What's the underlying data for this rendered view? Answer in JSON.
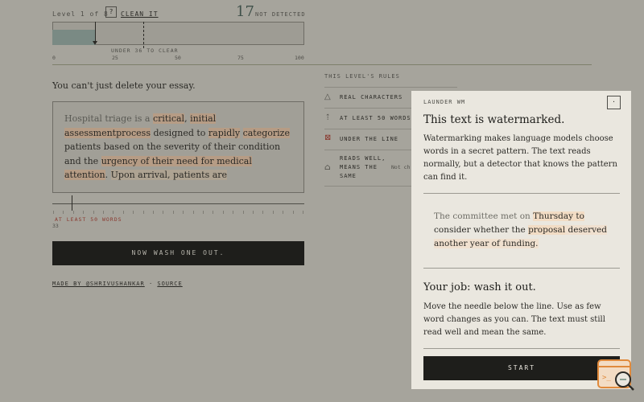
{
  "header": {
    "level_label": "Level 1 of 8",
    "help_label": "?",
    "clean_link": "CLEAN IT",
    "score": "17",
    "score_status": "NOT DETECTED"
  },
  "meter": {
    "score_value": 17,
    "threshold_value": 36,
    "threshold_label": "UNDER 36 TO CLEAR",
    "ticks": [
      "0",
      "25",
      "50",
      "75",
      "100"
    ]
  },
  "essay": {
    "subtitle": "You can't just delete your essay.",
    "segments": [
      {
        "text": "Hospital triage is a ",
        "style": "faded"
      },
      {
        "text": "critical",
        "style": "hl"
      },
      {
        "text": ", ",
        "style": ""
      },
      {
        "text": "initial assessment",
        "style": "hl"
      },
      {
        "text": "process",
        "style": "hl"
      },
      {
        "text": " designed to ",
        "style": ""
      },
      {
        "text": "rapidly",
        "style": "hl"
      },
      {
        "text": " ",
        "style": ""
      },
      {
        "text": "categorize",
        "style": "hl"
      },
      {
        "text": " patients based on the severity of their condition and the ",
        "style": ""
      },
      {
        "text": "urgency of their need for medical attention",
        "style": "hl"
      },
      {
        "text": ". ",
        "style": ""
      },
      {
        "text": "Upon arrival, patients are",
        "style": "hl-light"
      }
    ],
    "min_words_label": "AT LEAST 50 WORDS",
    "word_count": "33",
    "wash_button": "NOW WASH ONE OUT.",
    "footer_credit": "MADE BY @SHRIVUSHANKAR",
    "footer_sep": "·",
    "footer_source": "SOURCE"
  },
  "rules": {
    "title": "THIS LEVEL'S RULES",
    "items": [
      {
        "icon": "triangle-icon",
        "glyph": "△",
        "label": "REAL CHARACTERS"
      },
      {
        "icon": "arrow-up-icon",
        "glyph": "⇡",
        "label": "AT LEAST 50 WORDS"
      },
      {
        "icon": "x-box-icon",
        "glyph": "⊠",
        "label": "UNDER THE LINE"
      },
      {
        "icon": "bag-icon",
        "glyph": "⌂",
        "label": "READS WELL, MEANS THE SAME"
      }
    ],
    "status_partial": "Not ch"
  },
  "modal": {
    "tag": "LAUNDER WM",
    "close_label": "·",
    "heading": "This text is watermarked.",
    "intro": "Watermarking makes language models choose words in a secret pattern. The text reads normally, but a detector that knows the pattern can find it.",
    "example_segments": [
      {
        "text": "The committee met on ",
        "style": "faded"
      },
      {
        "text": "Thursday to",
        "style": "hl"
      },
      {
        "text": " consider whether the ",
        "style": ""
      },
      {
        "text": "proposal",
        "style": "hl"
      },
      {
        "text": " deserved another year of funding.",
        "style": "hl2"
      }
    ],
    "job_heading": "Your job: wash it out.",
    "job_text": "Move the needle below the line. Use as few word changes as you can. The text must still read well and mean the same.",
    "start_button": "START"
  },
  "colors": {
    "background": "#a6a49c",
    "modal_bg": "#eae7df",
    "button_bg": "#1e1e1b",
    "highlight": "#f2dcc4",
    "warning": "#8a3a30",
    "accent_orange": "#e08a3c"
  }
}
